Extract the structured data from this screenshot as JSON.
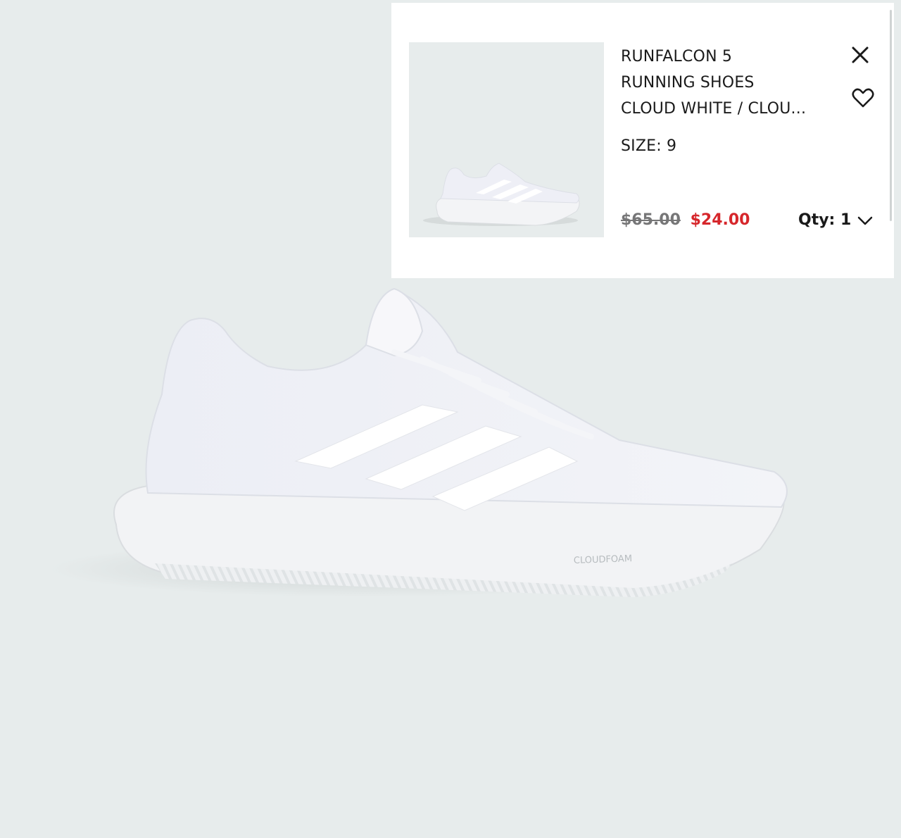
{
  "product": {
    "title_line1": "RUNFALCON 5",
    "title_line2": "RUNNING SHOES",
    "title_line3": "CLOUD WHITE / CLOU...",
    "size_label": "SIZE: 9",
    "original_price": "$65.00",
    "sale_price": "$24.00",
    "qty_label": "Qty: 1",
    "midsole_text": "CLOUDFOAM"
  },
  "icons": {
    "close": "close-icon",
    "wishlist": "heart-icon",
    "qty_dropdown": "chevron-down-icon"
  },
  "colors": {
    "background": "#e7ecec",
    "sale_price": "#d6262b",
    "original_price": "#767677",
    "text": "#1a1a1a"
  }
}
